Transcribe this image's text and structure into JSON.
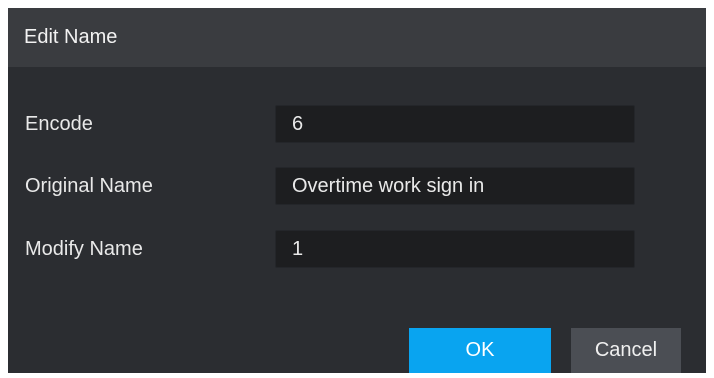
{
  "dialog": {
    "title": "Edit Name",
    "fields": [
      {
        "label": "Encode",
        "value": "6"
      },
      {
        "label": "Original Name",
        "value": "Overtime work sign in"
      },
      {
        "label": "Modify Name",
        "value": "1"
      }
    ],
    "ok_label": "OK",
    "cancel_label": "Cancel"
  },
  "colors": {
    "background": "#2b2d31",
    "titlebar": "#3a3c40",
    "field": "#1d1e20",
    "ok_button": "#09a4f0",
    "cancel_button": "#4b4e54"
  }
}
